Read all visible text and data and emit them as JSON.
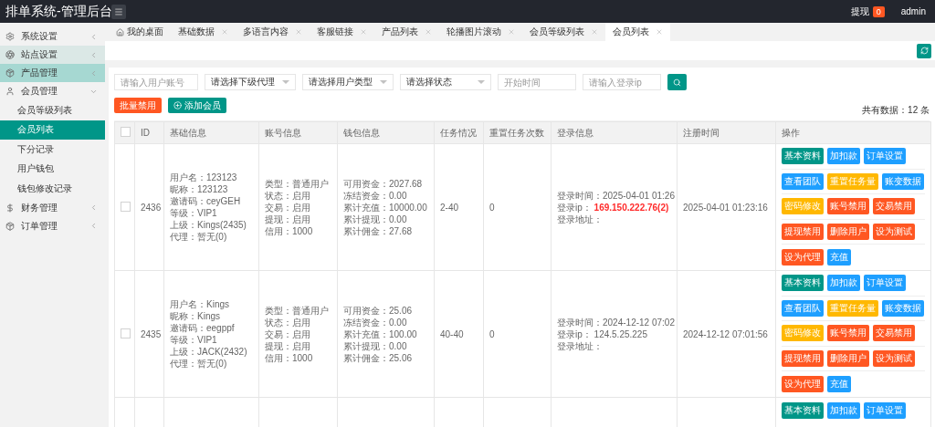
{
  "header": {
    "title": "排单系统-管理后台",
    "withdraw_label": "提现",
    "withdraw_count": "0",
    "user": "admin"
  },
  "sidebar": {
    "items": [
      {
        "label": "系统设置",
        "hovered": false,
        "active": false,
        "expanded": false
      },
      {
        "label": "站点设置",
        "hovered": true,
        "active": false,
        "expanded": false
      },
      {
        "label": "产品管理",
        "hovered": false,
        "active": true,
        "expanded": false
      },
      {
        "label": "会员管理",
        "hovered": false,
        "active": false,
        "expanded": true,
        "children": [
          {
            "label": "会员等级列表",
            "selected": false
          },
          {
            "label": "会员列表",
            "selected": true
          },
          {
            "label": "下分记录",
            "selected": false
          },
          {
            "label": "用户钱包",
            "selected": false
          },
          {
            "label": "钱包修改记录",
            "selected": false
          }
        ]
      },
      {
        "label": "财务管理",
        "hovered": false,
        "active": false,
        "expanded": false
      },
      {
        "label": "订单管理",
        "hovered": false,
        "active": false,
        "expanded": false
      }
    ]
  },
  "tabs": [
    {
      "label": "我的桌面",
      "kind": "home",
      "selected": false
    },
    {
      "label": "基础数据",
      "kind": "closable",
      "selected": false
    },
    {
      "label": "多语言内容",
      "kind": "closable",
      "selected": false
    },
    {
      "label": "客服链接",
      "kind": "closable",
      "selected": false
    },
    {
      "label": "产品列表",
      "kind": "closable",
      "selected": false
    },
    {
      "label": "轮播图片滚动",
      "kind": "closable",
      "selected": false
    },
    {
      "label": "会员等级列表",
      "kind": "closable",
      "selected": false
    },
    {
      "label": "会员列表",
      "kind": "closable",
      "selected": true
    }
  ],
  "filters": [
    {
      "kind": "input",
      "placeholder": "请输入用户账号"
    },
    {
      "kind": "select",
      "value": "请选择下级代理"
    },
    {
      "kind": "select",
      "value": "请选择用户类型"
    },
    {
      "kind": "select",
      "value": "请选择状态"
    },
    {
      "kind": "input",
      "placeholder": "开始时间"
    },
    {
      "kind": "input",
      "placeholder": "请输入登录ip"
    }
  ],
  "toolbar": {
    "buttons": [
      {
        "label": "批量禁用",
        "kind": "danger"
      },
      {
        "label": "添加会员",
        "kind": "add"
      }
    ],
    "total": "共有数据：12 条"
  },
  "table": {
    "header_checked": false,
    "columns": [
      "ID",
      "基础信息",
      "账号信息",
      "钱包信息",
      "任务情况",
      "重置任务次数",
      "登录信息",
      "注册时间",
      "操作"
    ],
    "rows": [
      {
        "checked": false,
        "id": "2436",
        "basic": [
          "用户名：123123",
          "昵称：123123",
          "邀请码：ceyGEH",
          "等级：VIP1",
          "上级：Kings(2435)",
          "代理：暂无(0)"
        ],
        "account": [
          "类型：普通用户",
          "状态：启用",
          "交易：启用",
          "提现：启用",
          "信用：1000"
        ],
        "wallet": [
          "可用资金：2027.68",
          "冻结资金：0.00",
          "累计充值：10000.00",
          "累计提现：0.00",
          "累计佣金：27.68"
        ],
        "task": "2-40",
        "resets": "0",
        "login": {
          "time": "登录时间：2025-04-01 01:26",
          "ip_label": "登录ip：",
          "ip": "169.150.222.76(2)",
          "ip_alert": true,
          "address": "登录地址："
        },
        "registered": "2025-04-01 01:23:16",
        "actions": [
          [
            {
              "label": "基本资料",
              "color": "#009688"
            },
            {
              "label": "加扣款",
              "color": "#1e9fff"
            },
            {
              "label": "订单设置",
              "color": "#1e9fff"
            }
          ],
          [
            {
              "label": "查看团队",
              "color": "#1e9fff"
            },
            {
              "label": "重置任务量",
              "color": "#ffb800"
            },
            {
              "label": "账变数据",
              "color": "#1e9fff"
            }
          ],
          [
            {
              "label": "密码修改",
              "color": "#ffb800"
            },
            {
              "label": "账号禁用",
              "color": "#ff5722"
            },
            {
              "label": "交易禁用",
              "color": "#ff5722"
            }
          ],
          [
            {
              "label": "提现禁用",
              "color": "#ff5722"
            },
            {
              "label": "删除用户",
              "color": "#ff5722"
            },
            {
              "label": "设为测试",
              "color": "#ff5722"
            }
          ],
          [
            {
              "label": "设为代理",
              "color": "#ff5722"
            },
            {
              "label": "充值",
              "color": "#1e9fff"
            }
          ]
        ]
      },
      {
        "checked": false,
        "id": "2435",
        "basic": [
          "用户名：Kings",
          "昵称：Kings",
          "邀请码：eegppf",
          "等级：VIP1",
          "上级：JACK(2432)",
          "代理：暂无(0)"
        ],
        "account": [
          "类型：普通用户",
          "状态：启用",
          "交易：启用",
          "提现：启用",
          "信用：1000"
        ],
        "wallet": [
          "可用资金：25.06",
          "冻结资金：0.00",
          "累计充值：100.00",
          "累计提现：0.00",
          "累计佣金：25.06"
        ],
        "task": "40-40",
        "resets": "0",
        "login": {
          "time": "登录时间：2024-12-12 07:02",
          "ip_label": "登录ip：",
          "ip": "124.5.25.225",
          "ip_alert": false,
          "address": "登录地址："
        },
        "registered": "2024-12-12 07:01:56",
        "actions": [
          [
            {
              "label": "基本资料",
              "color": "#009688"
            },
            {
              "label": "加扣款",
              "color": "#1e9fff"
            },
            {
              "label": "订单设置",
              "color": "#1e9fff"
            }
          ],
          [
            {
              "label": "查看团队",
              "color": "#1e9fff"
            },
            {
              "label": "重置任务量",
              "color": "#ffb800"
            },
            {
              "label": "账变数据",
              "color": "#1e9fff"
            }
          ],
          [
            {
              "label": "密码修改",
              "color": "#ffb800"
            },
            {
              "label": "账号禁用",
              "color": "#ff5722"
            },
            {
              "label": "交易禁用",
              "color": "#ff5722"
            }
          ],
          [
            {
              "label": "提现禁用",
              "color": "#ff5722"
            },
            {
              "label": "删除用户",
              "color": "#ff5722"
            },
            {
              "label": "设为测试",
              "color": "#ff5722"
            }
          ],
          [
            {
              "label": "设为代理",
              "color": "#ff5722"
            },
            {
              "label": "充值",
              "color": "#1e9fff"
            }
          ]
        ]
      },
      {
        "actions": [
          [
            {
              "label": "基本资料",
              "color": "#009688"
            },
            {
              "label": "加扣款",
              "color": "#1e9fff"
            },
            {
              "label": "订单设置",
              "color": "#1e9fff"
            }
          ]
        ]
      }
    ]
  }
}
